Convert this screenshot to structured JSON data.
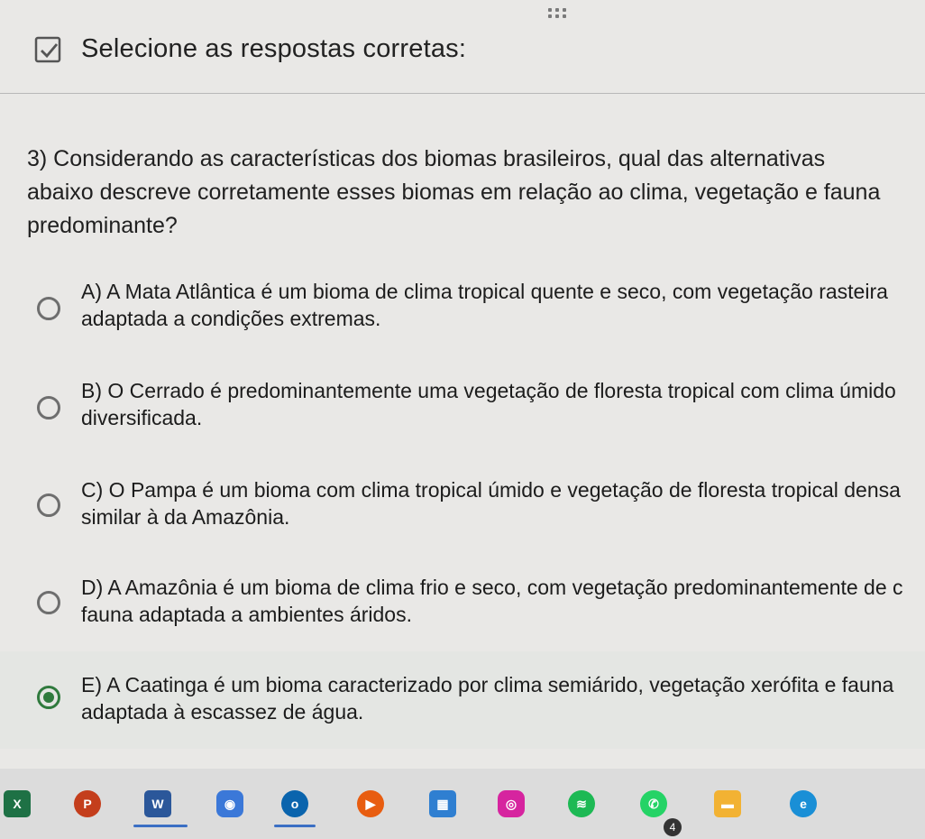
{
  "header": {
    "title": "Selecione as respostas corretas:"
  },
  "question": {
    "text": "3) Considerando as características dos biomas brasileiros, qual das alternativas abaixo descreve corretamente esses biomas em relação ao clima, vegetação e fauna predominante?"
  },
  "options": [
    {
      "line1": "A) A Mata Atlântica é um bioma de clima tropical quente e seco, com vegetação rasteira",
      "line2": "adaptada a condições extremas.",
      "selected": false
    },
    {
      "line1": "B) O Cerrado é predominantemente uma vegetação de floresta tropical com clima úmido",
      "line2": "diversificada.",
      "selected": false
    },
    {
      "line1": "C) O Pampa é um bioma com clima tropical úmido e vegetação de floresta tropical densa",
      "line2": "similar à da Amazônia.",
      "selected": false
    },
    {
      "line1": "D) A Amazônia é um bioma de clima frio e seco, com vegetação predominantemente de c",
      "line2": "fauna adaptada a ambientes áridos.",
      "selected": false
    },
    {
      "line1": "E) A Caatinga é um bioma caracterizado por clima semiárido, vegetação xerófita e fauna",
      "line2": "adaptada à escassez de água.",
      "selected": true
    }
  ],
  "taskbar": {
    "items": [
      {
        "icon": "excel-icon",
        "label": "X",
        "color": "#1e7145"
      },
      {
        "icon": "powerpoint-icon",
        "label": "P",
        "color": "#c43e1c"
      },
      {
        "icon": "word-icon",
        "label": "W",
        "color": "#2b579a"
      },
      {
        "icon": "camera-icon",
        "label": "",
        "color": "#3b78d8"
      },
      {
        "icon": "onedrive-icon",
        "label": "o",
        "color": "#0a64ad"
      },
      {
        "icon": "media-player-icon",
        "label": "▶",
        "color": "#e85d10"
      },
      {
        "icon": "store-icon",
        "label": "",
        "color": "#2f7fd1"
      },
      {
        "icon": "instagram-icon",
        "label": "",
        "color": "#d6249f"
      },
      {
        "icon": "spotify-icon",
        "label": "",
        "color": "#1db954"
      },
      {
        "icon": "whatsapp-icon",
        "label": "",
        "color": "#25d366"
      },
      {
        "icon": "file-explorer-icon",
        "label": "",
        "color": "#f2b233"
      },
      {
        "icon": "edge-icon",
        "label": "",
        "color": "#1a8fd6"
      }
    ],
    "whatsapp_badge": "4"
  }
}
